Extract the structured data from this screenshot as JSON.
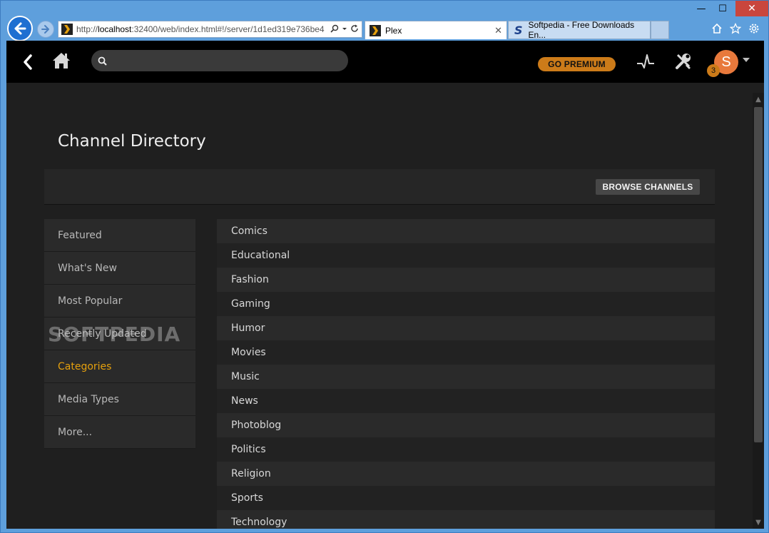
{
  "browser": {
    "address_host": "localhost",
    "address_url_rest": ":32400/web/index.html#!/server/1d1ed319e736be4",
    "address_prefix": "http://",
    "tabs": [
      {
        "label": "Plex",
        "active": true
      },
      {
        "label": "Softpedia - Free Downloads En...",
        "active": false
      }
    ],
    "window_controls": {
      "minimize": "—",
      "maximize": "☐",
      "close": "✕"
    }
  },
  "topbar": {
    "premium_label": "GO PREMIUM",
    "search_placeholder": "",
    "avatar_initial": "S",
    "notification_count": "3"
  },
  "page": {
    "title": "Channel Directory",
    "browse_label": "BROWSE CHANNELS"
  },
  "sidebar": {
    "items": [
      {
        "label": "Featured"
      },
      {
        "label": "What's New"
      },
      {
        "label": "Most Popular"
      },
      {
        "label": "Recently Updated"
      },
      {
        "label": "Categories",
        "active": true
      },
      {
        "label": "Media Types"
      },
      {
        "label": "More..."
      }
    ]
  },
  "categories": [
    "Comics",
    "Educational",
    "Fashion",
    "Gaming",
    "Humor",
    "Movies",
    "Music",
    "News",
    "Photoblog",
    "Politics",
    "Religion",
    "Sports",
    "Technology"
  ],
  "watermark": "SOFTPEDIA",
  "colors": {
    "accent": "#e5a00d",
    "premium": "#cc7b19",
    "avatar": "#e8793c",
    "background": "#1f1f1f",
    "topbar": "#000000"
  },
  "icons": {
    "back": "chevron-left-icon",
    "home": "home-icon",
    "search": "search-icon",
    "activity": "activity-icon",
    "settings": "wrench-screwdriver-icon",
    "dropdown": "caret-down-icon"
  }
}
